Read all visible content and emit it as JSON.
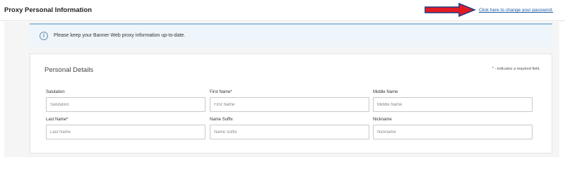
{
  "header": {
    "title": "Proxy Personal Information",
    "change_password_link": "Click here to change your password."
  },
  "banner": {
    "icon": "info-icon",
    "icon_glyph": "i",
    "message": "Please keep your Banner Web proxy information up-to-date."
  },
  "personal_details": {
    "title": "Personal Details",
    "required_note": "* - indicates a required field.",
    "fields": {
      "salutation": {
        "label": "Salutation",
        "placeholder": "Salutation",
        "value": ""
      },
      "first_name": {
        "label": "First Name*",
        "placeholder": "First Name",
        "value": ""
      },
      "middle_name": {
        "label": "Middle Name",
        "placeholder": "Middle Name",
        "value": ""
      },
      "last_name": {
        "label": "Last Name*",
        "placeholder": "Last Name",
        "value": ""
      },
      "name_suffix": {
        "label": "Name Suffix",
        "placeholder": "Name Suffix",
        "value": ""
      },
      "nickname": {
        "label": "Nickname",
        "placeholder": "Nickname",
        "value": ""
      }
    }
  },
  "colors": {
    "arrow_fill": "#e31b23",
    "arrow_outline": "#1f3a8a",
    "link": "#1a5aa8",
    "banner_bg": "#eef5fb",
    "banner_border": "#9cc3df"
  }
}
